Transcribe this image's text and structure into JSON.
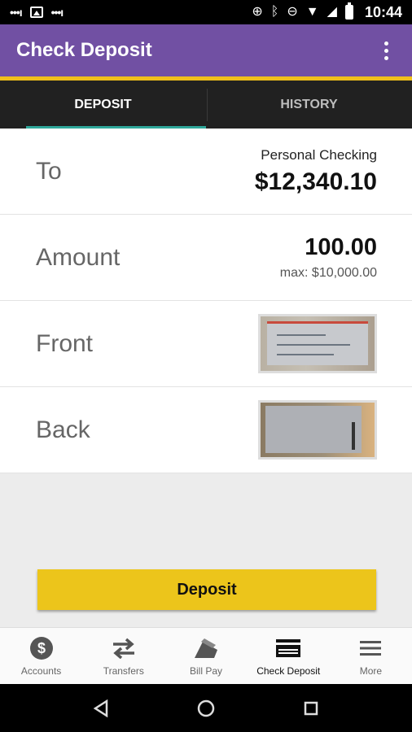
{
  "status_bar": {
    "time": "10:44"
  },
  "app_bar": {
    "title": "Check Deposit"
  },
  "tabs": [
    {
      "label": "DEPOSIT",
      "active": true
    },
    {
      "label": "HISTORY",
      "active": false
    }
  ],
  "form": {
    "to": {
      "label": "To",
      "account": "Personal Checking",
      "balance": "$12,340.10"
    },
    "amount": {
      "label": "Amount",
      "value": "100.00",
      "max": "max: $10,000.00"
    },
    "front": {
      "label": "Front"
    },
    "back": {
      "label": "Back"
    }
  },
  "deposit_button": {
    "label": "Deposit"
  },
  "bottom_nav": [
    {
      "label": "Accounts",
      "icon": "dollar-circle-icon"
    },
    {
      "label": "Transfers",
      "icon": "transfer-arrows-icon"
    },
    {
      "label": "Bill Pay",
      "icon": "bill-pay-icon"
    },
    {
      "label": "Check Deposit",
      "icon": "check-card-icon",
      "active": true
    },
    {
      "label": "More",
      "icon": "menu-icon"
    }
  ],
  "colors": {
    "primary": "#7150a3",
    "accent": "#f0c01a",
    "tab_indicator": "#2fa89b",
    "button": "#ecc51b"
  }
}
